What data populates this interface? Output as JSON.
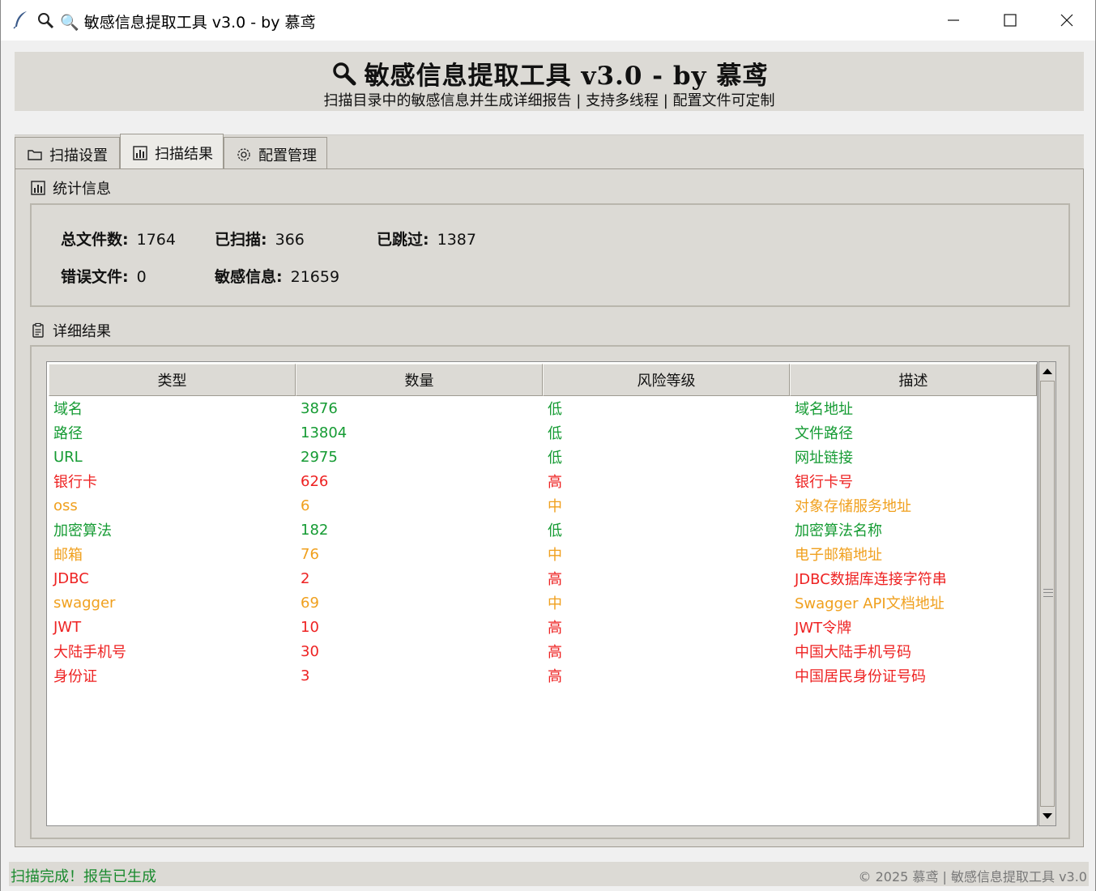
{
  "window": {
    "title": "🔍 敏感信息提取工具 v3.0 - by 慕鸢"
  },
  "header": {
    "title": "敏感信息提取工具 v3.0 - by 慕鸢",
    "subtitle": "扫描目录中的敏感信息并生成详细报告 | 支持多线程 | 配置文件可定制"
  },
  "tabs": [
    {
      "label": "扫描设置",
      "icon": "folder-icon",
      "selected": false
    },
    {
      "label": "扫描结果",
      "icon": "chart-icon",
      "selected": true
    },
    {
      "label": "配置管理",
      "icon": "gear-icon",
      "selected": false
    }
  ],
  "stats": {
    "section_label": "统计信息",
    "total_files_label": "总文件数:",
    "total_files": "1764",
    "scanned_label": "已扫描:",
    "scanned": "366",
    "skipped_label": "已跳过:",
    "skipped": "1387",
    "errors_label": "错误文件:",
    "errors": "0",
    "sensitive_label": "敏感信息:",
    "sensitive": "21659"
  },
  "details": {
    "section_label": "详细结果",
    "columns": [
      "类型",
      "数量",
      "风险等级",
      "描述"
    ],
    "rows": [
      {
        "type": "域名",
        "count": "3876",
        "risk": "低",
        "desc": "域名地址",
        "level": "low"
      },
      {
        "type": "路径",
        "count": "13804",
        "risk": "低",
        "desc": "文件路径",
        "level": "low"
      },
      {
        "type": "URL",
        "count": "2975",
        "risk": "低",
        "desc": "网址链接",
        "level": "low"
      },
      {
        "type": "银行卡",
        "count": "626",
        "risk": "高",
        "desc": "银行卡号",
        "level": "high"
      },
      {
        "type": "oss",
        "count": "6",
        "risk": "中",
        "desc": "对象存储服务地址",
        "level": "mid"
      },
      {
        "type": "加密算法",
        "count": "182",
        "risk": "低",
        "desc": "加密算法名称",
        "level": "low"
      },
      {
        "type": "邮箱",
        "count": "76",
        "risk": "中",
        "desc": "电子邮箱地址",
        "level": "mid"
      },
      {
        "type": "JDBC",
        "count": "2",
        "risk": "高",
        "desc": "JDBC数据库连接字符串",
        "level": "high"
      },
      {
        "type": "swagger",
        "count": "69",
        "risk": "中",
        "desc": "Swagger API文档地址",
        "level": "mid"
      },
      {
        "type": "JWT",
        "count": "10",
        "risk": "高",
        "desc": "JWT令牌",
        "level": "high"
      },
      {
        "type": "大陆手机号",
        "count": "30",
        "risk": "高",
        "desc": "中国大陆手机号码",
        "level": "high"
      },
      {
        "type": "身份证",
        "count": "3",
        "risk": "高",
        "desc": "中国居民身份证号码",
        "level": "high"
      }
    ]
  },
  "statusbar": {
    "status": "扫描完成！报告已生成",
    "copyright": "© 2025 慕鸢 | 敏感信息提取工具 v3.0"
  },
  "colors": {
    "risk_low": "#159b33",
    "risk_mid": "#f0a01e",
    "risk_high": "#ee2222",
    "status_ok": "#1a8a2e"
  }
}
